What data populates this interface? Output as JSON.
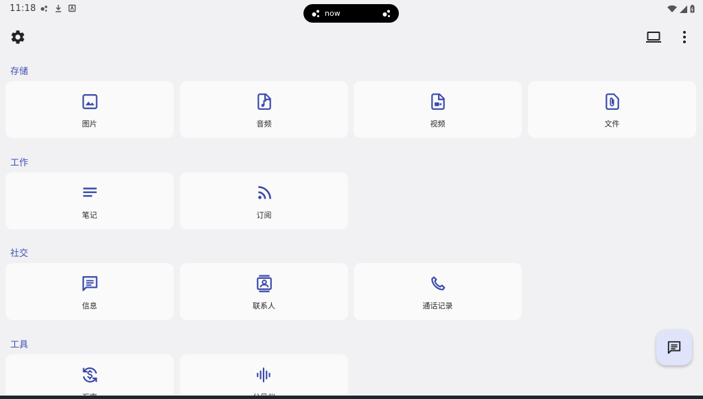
{
  "status_bar": {
    "time": "11:18",
    "left_icons": [
      "notification-dots-icon",
      "download-icon",
      "app-badge-icon"
    ],
    "right_icons": [
      "wifi-icon",
      "signal-icon",
      "battery-icon"
    ]
  },
  "notification_pill": {
    "text": "now"
  },
  "app_bar": {
    "left_icon": "settings-icon",
    "right_icons": [
      "laptop-icon",
      "more-vert-icon"
    ]
  },
  "sections": [
    {
      "title": "存储",
      "items": [
        {
          "label": "图片",
          "icon": "image-icon"
        },
        {
          "label": "音频",
          "icon": "audio-file-icon"
        },
        {
          "label": "视频",
          "icon": "video-file-icon"
        },
        {
          "label": "文件",
          "icon": "attachment-file-icon"
        }
      ]
    },
    {
      "title": "工作",
      "items": [
        {
          "label": "笔记",
          "icon": "notes-icon"
        },
        {
          "label": "订阅",
          "icon": "rss-icon"
        }
      ]
    },
    {
      "title": "社交",
      "items": [
        {
          "label": "信息",
          "icon": "message-icon"
        },
        {
          "label": "联系人",
          "icon": "contacts-icon"
        },
        {
          "label": "通话记录",
          "icon": "phone-icon"
        }
      ]
    },
    {
      "title": "工具",
      "items": [
        {
          "label": "汇率",
          "icon": "currency-exchange-icon"
        },
        {
          "label": "分贝仪",
          "icon": "sound-wave-icon"
        }
      ]
    }
  ],
  "fab": {
    "icon": "chat-icon"
  },
  "colors": {
    "accent": "#3f51b5",
    "icon": "#3949ab",
    "background": "#f1f1f3",
    "card": "#fafafa",
    "fab": "#dfe4fb"
  }
}
